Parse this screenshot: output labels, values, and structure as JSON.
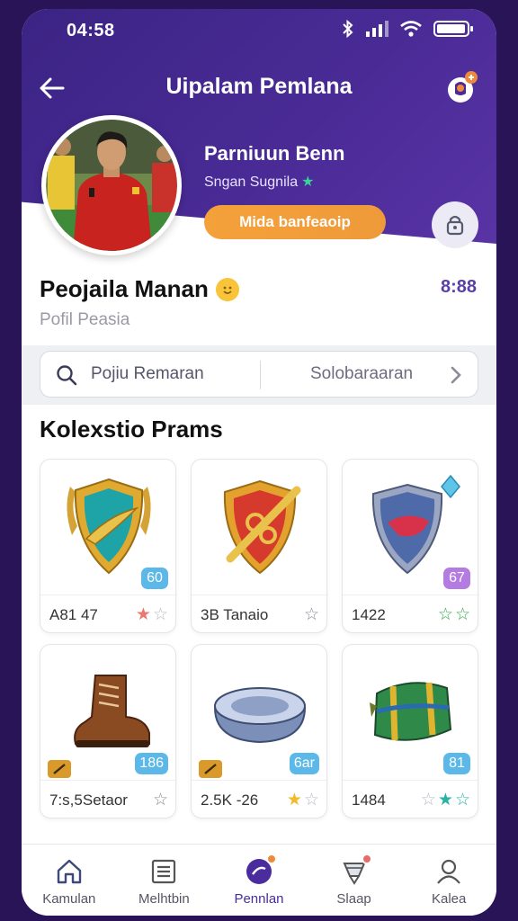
{
  "status_bar": {
    "time": "04:58"
  },
  "app_bar": {
    "title": "Uipalam Pemlana"
  },
  "profile": {
    "name": "Parniuun Benn",
    "subtitle": "Sngan Sugnila",
    "edit_button": "Mida banfeaoip"
  },
  "player": {
    "name": "Peojaila Manan",
    "subtitle": "Pofil Peasia",
    "code": "8:88"
  },
  "search": {
    "placeholder": "Pojiu Remaran",
    "sort_label": "Solobaraaran"
  },
  "collection": {
    "title": "Kolexstio Prams",
    "items": [
      {
        "icon": "teal-gold-shield-icon",
        "badge": "60",
        "badge_color": "#5bb8e8",
        "label": "A81 47",
        "stars": [
          {
            "c": "#e9786e",
            "f": true
          },
          {
            "c": "#b9b9c4",
            "f": false
          }
        ]
      },
      {
        "icon": "red-gold-shield-icon",
        "badge": "",
        "label": "3B Tanaio",
        "stars": [
          {
            "c": "#8a8a96",
            "f": false
          }
        ]
      },
      {
        "icon": "silver-red-shield-icon",
        "badge": "67",
        "badge_color": "#b47be0",
        "label": "1422",
        "stars": [
          {
            "c": "#2faa4a",
            "f": false
          },
          {
            "c": "#2faa4a",
            "f": false
          }
        ]
      },
      {
        "icon": "brown-boot-icon",
        "badge": "186",
        "badge_color": "#5bb8e8",
        "chip": true,
        "label": "7:s,5Setaor",
        "stars": [
          {
            "c": "#8a8a96",
            "f": false
          }
        ]
      },
      {
        "icon": "steel-bowl-icon",
        "badge": "6ar",
        "badge_color": "#5bb8e8",
        "chip": true,
        "label": "2.5K -26",
        "stars": [
          {
            "c": "#f2b928",
            "f": true
          },
          {
            "c": "#b9b9c4",
            "f": false
          }
        ]
      },
      {
        "icon": "green-bag-icon",
        "badge": "81",
        "badge_color": "#5bb8e8",
        "label": "1484",
        "stars": [
          {
            "c": "#b9b9c4",
            "f": false
          },
          {
            "c": "#2ab3a3",
            "f": true
          },
          {
            "c": "#2ab3a3",
            "f": false
          }
        ]
      }
    ]
  },
  "bottom_nav": [
    {
      "label": "Kamulan",
      "icon": "home-icon"
    },
    {
      "label": "Melhtbin",
      "icon": "list-icon"
    },
    {
      "label": "Pennlan",
      "icon": "chat-icon",
      "active": true
    },
    {
      "label": "Slaap",
      "icon": "trophy-icon"
    },
    {
      "label": "Kalea",
      "icon": "user-icon"
    }
  ],
  "colors": {
    "accent": "#4a2b96",
    "cta": "#f5a13a",
    "background": "#2a1458"
  }
}
